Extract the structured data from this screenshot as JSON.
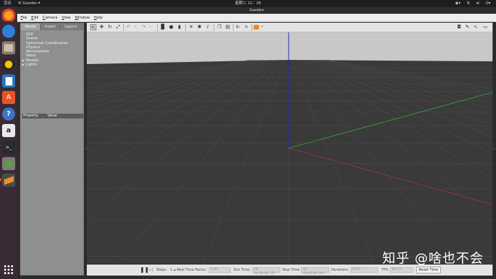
{
  "system": {
    "activities": "活动",
    "app_name": "Gazebo",
    "clock": "星期二 11：26"
  },
  "window": {
    "title": "Gazebo"
  },
  "menu": [
    "File",
    "Edit",
    "Camera",
    "View",
    "Window",
    "Help"
  ],
  "left_panel": {
    "tabs": [
      "World",
      "Insert",
      "Layers"
    ],
    "tree": [
      "GUI",
      "Scene",
      "Spherical Coordinates",
      "Physics",
      "Atmosphere",
      "Wind",
      "Models",
      "Lights"
    ],
    "property_header": "Property",
    "value_header": "Value"
  },
  "bottom": {
    "steps_label": "Steps:",
    "steps_value": "1",
    "rtf_label": "Real Time Factor:",
    "rtf_value": "0.99",
    "sim_time_label": "Sim Time:",
    "sim_time_value": "00 00:00:06.737",
    "real_time_label": "Real Time:",
    "real_time_value": "00 00:00:06.793",
    "iterations_label": "Iterations:",
    "iterations_value": "6737",
    "fps_label": "FPS:",
    "fps_value": "60.53",
    "reset_label": "Reset Time"
  },
  "watermark": "知乎 @啥也不会",
  "colors": {
    "accent": "#e95420",
    "x_axis": "#a83232",
    "y_axis": "#3a9b3a",
    "z_axis": "#2727c8",
    "sky": "#c8c8c8",
    "ground": "#3a3a3a"
  }
}
